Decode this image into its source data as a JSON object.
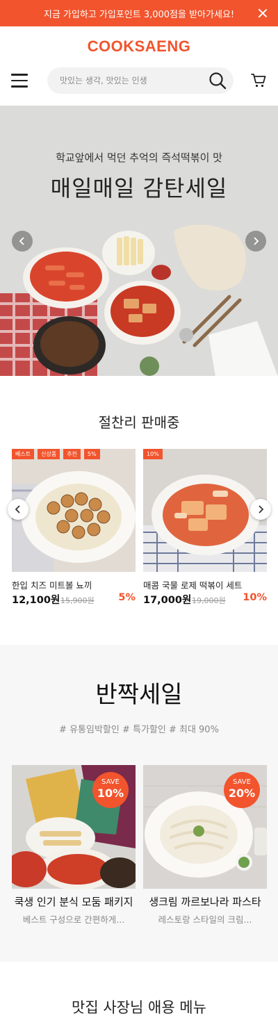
{
  "promo_bar": {
    "text": "지금 가입하고 가입포인트 3,000점을 받아가세요!"
  },
  "header": {
    "logo": "COOKSAENG",
    "search_placeholder": "맛있는 생각, 맛있는 인생"
  },
  "hero": {
    "subtitle": "학교앞에서 먹던 추억의 즉석떡볶이 맛",
    "title": "매일매일 감탄세일"
  },
  "best_section": {
    "title": "절찬리 판매중",
    "products": [
      {
        "badges": [
          "베스트",
          "신상품",
          "추천",
          "5%"
        ],
        "name": "한입 치즈 미트볼 뇨끼",
        "price": "12,100원",
        "original_price": "15,900원",
        "discount": "5%"
      },
      {
        "badges": [
          "10%"
        ],
        "name": "매콤 국물 로제 떡볶이 세트",
        "price": "17,000원",
        "original_price": "19,000원",
        "discount": "10%"
      }
    ]
  },
  "half_sale": {
    "title": "반짝세일",
    "tags": "# 유통임박할인  # 특가할인  # 최대 90%",
    "products": [
      {
        "save_label": "SAVE",
        "save_rate": "10%",
        "name": "쿡생 인기 분식 모둠 패키지",
        "desc": "베스트 구성으로 간편하게..."
      },
      {
        "save_label": "SAVE",
        "save_rate": "20%",
        "name": "생크림 까르보나라 파스타",
        "desc": "레스토랑 스타일의 크림..."
      }
    ]
  },
  "owner_section": {
    "title": "맛집 사장님 애용 메뉴"
  },
  "colors": {
    "accent": "#f2542d"
  }
}
